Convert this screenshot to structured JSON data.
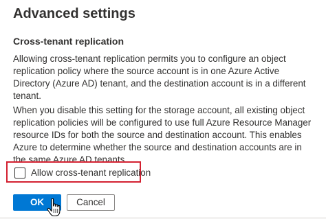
{
  "dialog": {
    "title": "Advanced settings",
    "section_heading": "Cross-tenant replication",
    "paragraph_1": [
      "Allowing cross-tenant replication permits you to configure an object",
      "replication policy where the source account is in one Azure Active",
      "Directory (Azure AD) tenant, and the destination account is in a different",
      "tenant."
    ],
    "paragraph_2": [
      "When you disable this setting for the storage account, all existing object",
      "replication policies will be configured to use full Azure Resource Manager",
      "resource IDs for both the source and destination account. This enables",
      "Azure to determine whether the source and destination accounts are in",
      "the same Azure AD tenants."
    ],
    "checkbox": {
      "label": "Allow cross-tenant replication",
      "checked": false
    },
    "buttons": {
      "ok_label": "OK",
      "cancel_label": "Cancel"
    }
  },
  "colors": {
    "primary": "#0078d4",
    "highlight_border": "#d32030",
    "text": "#323130"
  },
  "icons": {
    "cursor": "hand-pointer-icon"
  }
}
